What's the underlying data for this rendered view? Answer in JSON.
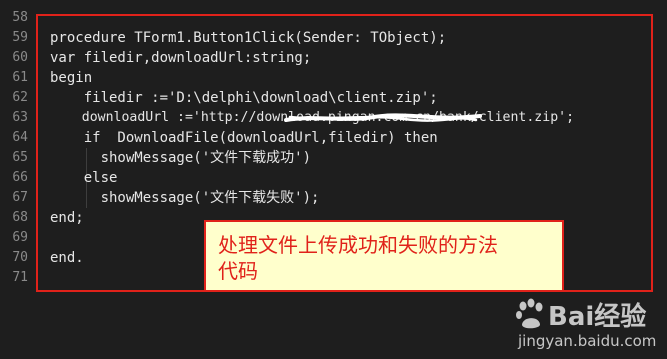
{
  "editor": {
    "line_numbers": [
      "58",
      "59",
      "60",
      "61",
      "62",
      "63",
      "64",
      "65",
      "66",
      "67",
      "68",
      "69",
      "70",
      "71"
    ],
    "code_lines": [
      "",
      "procedure TForm1.Button1Click(Sender: TObject);",
      "var filedir,downloadUrl:string;",
      "begin",
      "    filedir :='D:\\delphi\\download\\client.zip';",
      "    downloadUrl :='http://download.pingan.com.cn/bank/client.zip';",
      "    if  DownloadFile(downloadUrl,filedir) then",
      "      showMessage('文件下载成功')",
      "    else",
      "      showMessage('文件下载失败');",
      "end;",
      "",
      "end.",
      ""
    ]
  },
  "annotation": {
    "line1": "处理文件上传成功和失败的方法",
    "line2": "代码",
    "box_color": "#e0221a",
    "note_bg": "#ffffcc"
  },
  "watermark": {
    "brand": "Bai经验",
    "url": "jingyan.baidu.com"
  }
}
